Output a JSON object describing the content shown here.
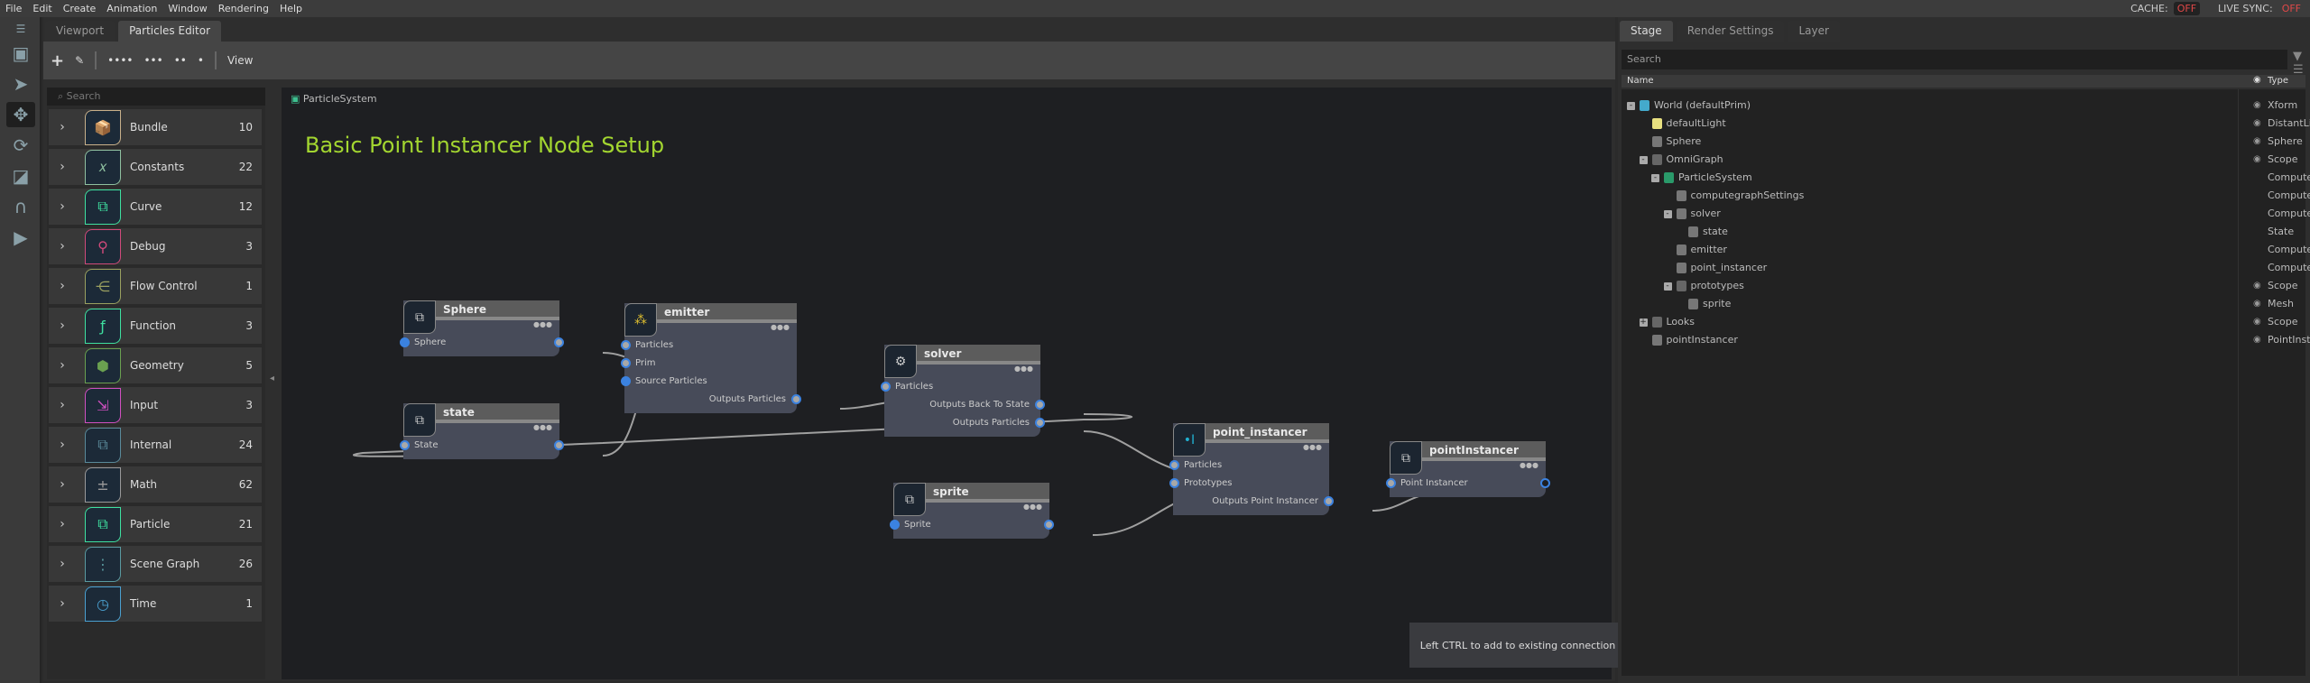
{
  "menu": [
    "File",
    "Edit",
    "Create",
    "Animation",
    "Window",
    "Rendering",
    "Help"
  ],
  "status": {
    "cache_label": "CACHE:",
    "cache_value": "OFF",
    "sync_label": "LIVE SYNC:",
    "sync_value": "OFF"
  },
  "editor": {
    "tabs": [
      "Viewport",
      "Particles Editor"
    ],
    "active_tab": "Particles Editor",
    "toolbar_view": "View",
    "search_placeholder": "Search"
  },
  "palette": [
    {
      "label": "Bundle",
      "count": "10",
      "color": "#c8b08a",
      "icon": "box-icon"
    },
    {
      "label": "Constants",
      "count": "22",
      "color": "#8fc0a0",
      "icon": "x-variable-icon"
    },
    {
      "label": "Curve",
      "count": "12",
      "color": "#3ee0a0",
      "icon": "node-icon"
    },
    {
      "label": "Debug",
      "count": "3",
      "color": "#d04a7a",
      "icon": "bug-search-icon"
    },
    {
      "label": "Flow Control",
      "count": "1",
      "color": "#9aa060",
      "icon": "flow-icon"
    },
    {
      "label": "Function",
      "count": "3",
      "color": "#3ee0a0",
      "icon": "function-icon"
    },
    {
      "label": "Geometry",
      "count": "5",
      "color": "#6aa050",
      "icon": "cube-icon"
    },
    {
      "label": "Input",
      "count": "3",
      "color": "#d050c0",
      "icon": "input-icon"
    },
    {
      "label": "Internal",
      "count": "24",
      "color": "#5a8a9a",
      "icon": "node-icon"
    },
    {
      "label": "Math",
      "count": "62",
      "color": "#999999",
      "icon": "math-icon"
    },
    {
      "label": "Particle",
      "count": "21",
      "color": "#3ee0a0",
      "icon": "node-icon"
    },
    {
      "label": "Scene Graph",
      "count": "26",
      "color": "#5a9aa0",
      "icon": "tree-icon"
    },
    {
      "label": "Time",
      "count": "1",
      "color": "#4aa0d0",
      "icon": "clock-icon"
    }
  ],
  "graph": {
    "breadcrumb": "ParticleSystem",
    "title": "Basic Point Instancer Node Setup",
    "title_color": "#a3d630",
    "nodes": {
      "sphere": {
        "title": "Sphere",
        "in": [
          "Sphere"
        ]
      },
      "state": {
        "title": "state",
        "in": [
          "State"
        ]
      },
      "emitter": {
        "title": "emitter",
        "in": [
          "Particles",
          "Prim",
          "Source Particles"
        ],
        "out": [
          "Outputs Particles"
        ]
      },
      "solver": {
        "title": "solver",
        "in": [
          "Particles"
        ],
        "out": [
          "Outputs Back To State",
          "Outputs Particles"
        ]
      },
      "sprite": {
        "title": "sprite",
        "in": [
          "Sprite"
        ]
      },
      "point_instancer": {
        "title": "point_instancer",
        "in": [
          "Particles",
          "Prototypes"
        ],
        "out": [
          "Outputs Point Instancer"
        ]
      },
      "pointInstancer": {
        "title": "pointInstancer",
        "in": [
          "Point Instancer"
        ]
      }
    },
    "tooltip": "Left CTRL to add to existing connection"
  },
  "stage": {
    "tabs": [
      "Stage",
      "Render Settings",
      "Layer"
    ],
    "search_placeholder": "Search",
    "col_name": "Name",
    "col_type": "Type",
    "rows": [
      {
        "name": "World (defaultPrim)",
        "type": "Xform",
        "depth": 0,
        "toggle": "-",
        "eye": true,
        "icon": "xform-icon"
      },
      {
        "name": "defaultLight",
        "type": "DistantLight",
        "depth": 1,
        "eye": true,
        "icon": "light-icon"
      },
      {
        "name": "Sphere",
        "type": "Sphere",
        "depth": 1,
        "eye": true,
        "icon": "prim-icon"
      },
      {
        "name": "OmniGraph",
        "type": "Scope",
        "depth": 1,
        "toggle": "-",
        "eye": true,
        "icon": "folder-icon"
      },
      {
        "name": "ParticleSystem",
        "type": "ComputeGraph",
        "depth": 2,
        "toggle": "-",
        "icon": "graph-icon"
      },
      {
        "name": "computegraphSettings",
        "type": "ComputeGraphSettings",
        "depth": 3,
        "icon": "prim-icon"
      },
      {
        "name": "solver",
        "type": "ComputeNode",
        "depth": 3,
        "toggle": "-",
        "icon": "prim-icon"
      },
      {
        "name": "state",
        "type": "State",
        "depth": 4,
        "icon": "prim-icon"
      },
      {
        "name": "emitter",
        "type": "ComputeNode",
        "depth": 3,
        "icon": "prim-icon"
      },
      {
        "name": "point_instancer",
        "type": "ComputeNode",
        "depth": 3,
        "icon": "prim-icon"
      },
      {
        "name": "prototypes",
        "type": "Scope",
        "depth": 3,
        "toggle": "-",
        "eye": true,
        "icon": "folder-icon"
      },
      {
        "name": "sprite",
        "type": "Mesh",
        "depth": 4,
        "eye": true,
        "icon": "prim-icon"
      },
      {
        "name": "Looks",
        "type": "Scope",
        "depth": 1,
        "toggle": "+",
        "eye": true,
        "icon": "folder-icon"
      },
      {
        "name": "pointInstancer",
        "type": "PointInstancer",
        "depth": 1,
        "eye": true,
        "icon": "prim-icon"
      }
    ]
  }
}
